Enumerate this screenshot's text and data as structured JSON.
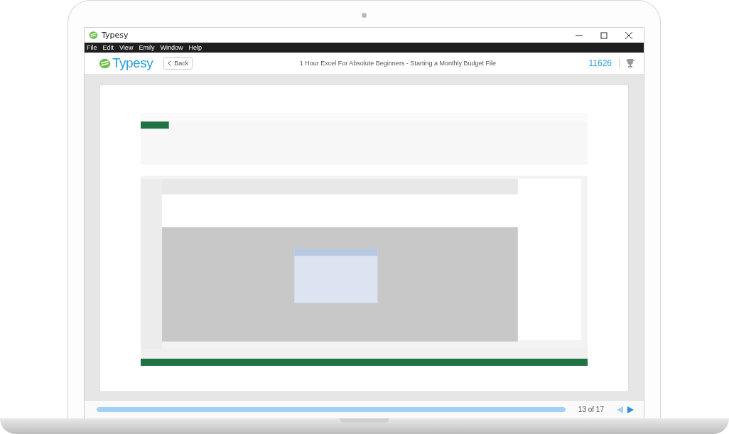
{
  "window": {
    "title": "Typesy"
  },
  "menu": [
    {
      "label": "File"
    },
    {
      "label": "Edit"
    },
    {
      "label": "View"
    },
    {
      "label": "Emily"
    },
    {
      "label": "Window"
    },
    {
      "label": "Help"
    }
  ],
  "header": {
    "logo": "Typesy",
    "back": "Back",
    "lesson_title": "1 Hour Excel For Absolute Beginners - Starting a Monthly Budget File",
    "score": "11626"
  },
  "footer": {
    "progress": {
      "level": 1
    },
    "counter": "13 of 17",
    "prev": {
      "disabled": true
    },
    "next": {
      "disabled": false
    }
  }
}
